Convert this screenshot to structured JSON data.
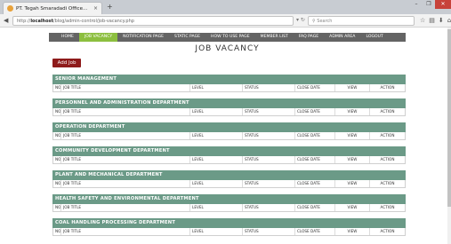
{
  "browser": {
    "tab_title": "PT. Tegah Smaradadi Office...",
    "tab_close": "×",
    "new_tab": "+",
    "url_prefix": "http://",
    "url_host": "localhost",
    "url_path": "/blog/admin-control/job-vacancy.php",
    "search_placeholder": "Search",
    "window_controls": {
      "minimize": "–",
      "maximize": "❐",
      "close": "✕"
    }
  },
  "nav": {
    "items": [
      {
        "label": "HOME",
        "active": false
      },
      {
        "label": "JOB VACANCY",
        "active": true
      },
      {
        "label": "NOTIFICATION PAGE",
        "active": false
      },
      {
        "label": "STATIC PAGE",
        "active": false
      },
      {
        "label": "HOW TO USE PAGE",
        "active": false
      },
      {
        "label": "MEMBER LIST",
        "active": false
      },
      {
        "label": "FAQ PAGE",
        "active": false
      },
      {
        "label": "ADMIN AREA",
        "active": false
      },
      {
        "label": "LOGOUT",
        "active": false
      }
    ]
  },
  "page": {
    "title": "JOB VACANCY",
    "add_button": "Add Job"
  },
  "columns": {
    "no": "NO",
    "job_title": "JOB TITLE",
    "level": "LEVEL",
    "status": "STATUS",
    "close_date": "CLOSE DATE",
    "view": "VIEW",
    "action": "ACTION"
  },
  "departments": [
    "SENIOR MANAGEMENT",
    "PERSONNEL AND ADMINISTRATION DEPARTMENT",
    "OPERATION DEPARTMENT",
    "COMMUNITY DEVELOPMENT DEPARTMENT",
    "PLANT AND MECHANICAL DEPARTMENT",
    "HEALTH SAFETY AND ENVIRONMENTAL DEPARTMENT",
    "COAL HANDLING PROCESSING DEPARTMENT"
  ],
  "colors": {
    "nav_bg": "#646464",
    "nav_active": "#8cbf3f",
    "dept_header": "#6b9a87",
    "add_button": "#8e1b1b"
  }
}
